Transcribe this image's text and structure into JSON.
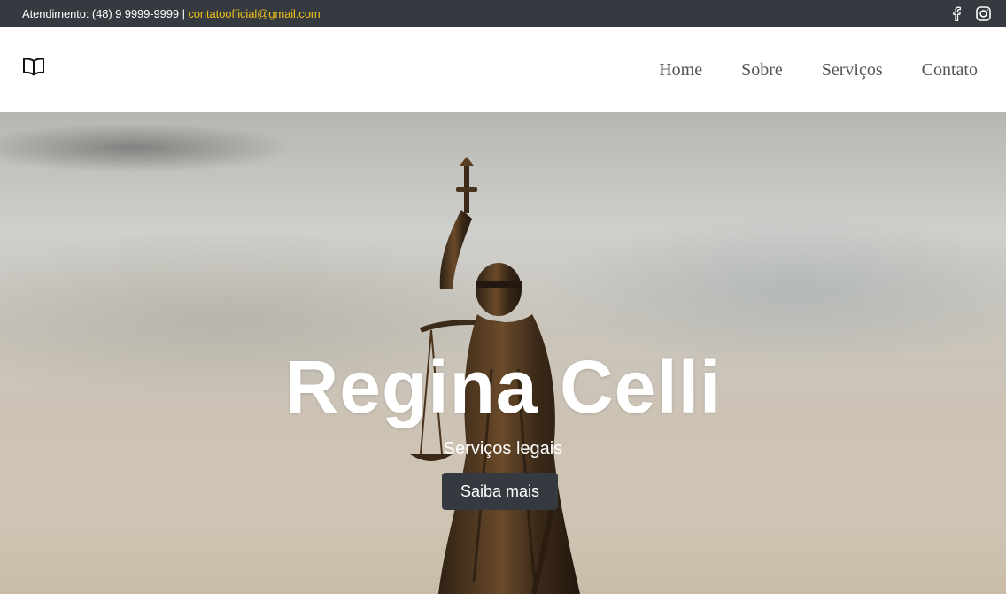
{
  "topbar": {
    "contact_prefix": "Atendimento: (48) 9 9999-9999 | ",
    "email": "contatoofficial@gmail.com",
    "background_color": "#343a40",
    "email_color": "#f2c21a",
    "icons": [
      "facebook-icon",
      "instagram-icon"
    ]
  },
  "navbar": {
    "logo_icon": "open-book-icon",
    "menu": [
      "Home",
      "Sobre",
      "Serviços",
      "Contato"
    ]
  },
  "hero": {
    "title": "Regina Celli",
    "subtitle": "Serviços legais",
    "button_label": "Saiba mais",
    "button_color": "#343a40"
  }
}
